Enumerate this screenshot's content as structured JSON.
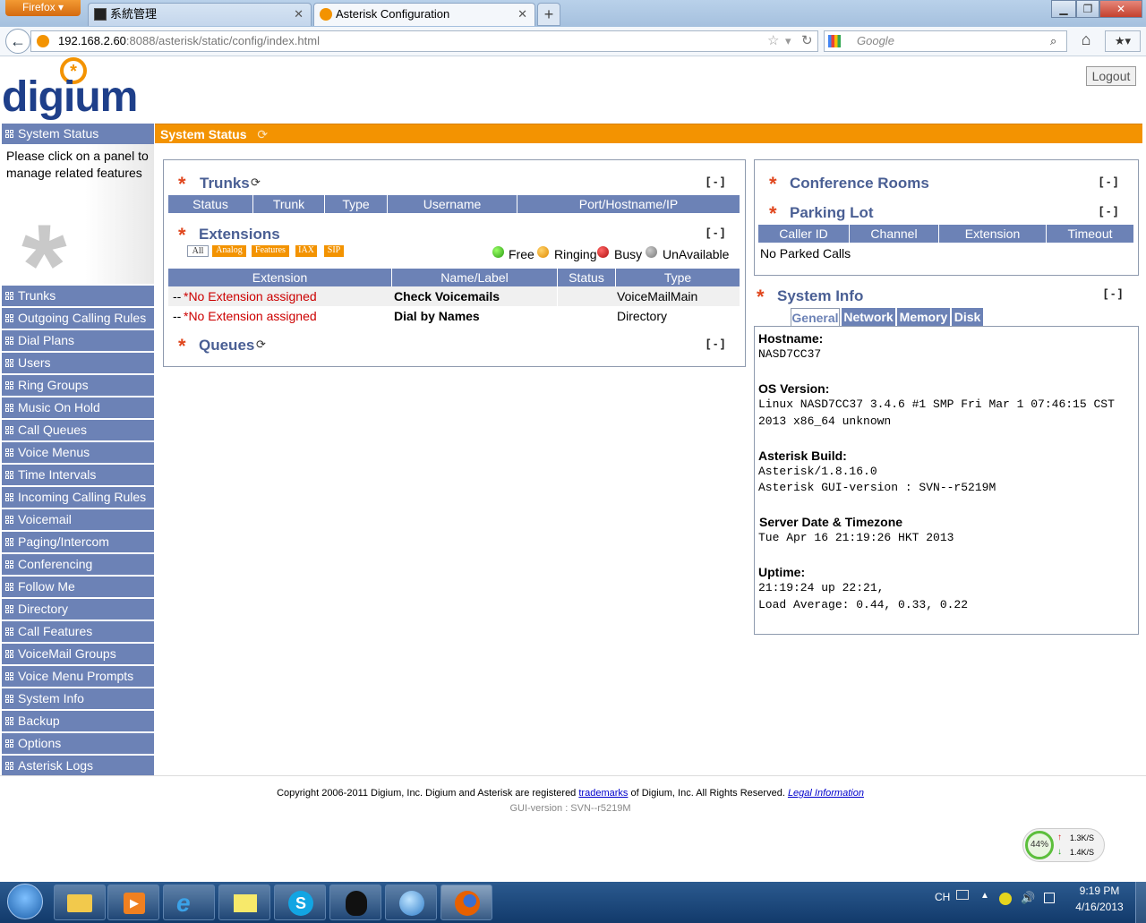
{
  "browser": {
    "menu_button": "Firefox",
    "tabs": [
      {
        "label": "系統管理"
      },
      {
        "label": "Asterisk Configuration"
      }
    ],
    "new_tab": "+",
    "url_host": "192.168.2.60",
    "url_path": ":8088/asterisk/static/config/index.html",
    "search_placeholder": "Google"
  },
  "header": {
    "logo_text": "digium",
    "logout_label": "Logout"
  },
  "sidebar": {
    "head_label": "System Status",
    "description": "Please click on a panel to manage related features",
    "items": [
      "Trunks",
      "Outgoing Calling Rules",
      "Dial Plans",
      "Users",
      "Ring Groups",
      "Music On Hold",
      "Call Queues",
      "Voice Menus",
      "Time Intervals",
      "Incoming Calling Rules",
      "Voicemail",
      "Paging/Intercom",
      "Conferencing",
      "Follow Me",
      "Directory",
      "Call Features",
      "VoiceMail Groups",
      "Voice Menu Prompts",
      "System Info",
      "Backup",
      "Options",
      "Asterisk Logs"
    ]
  },
  "status_bar": {
    "title": "System Status"
  },
  "trunks": {
    "title": "Trunks",
    "collapse": "[ - ]",
    "columns": [
      "Status",
      "Trunk",
      "Type",
      "Username",
      "Port/Hostname/IP"
    ]
  },
  "extensions": {
    "title": "Extensions",
    "collapse": "[ - ]",
    "filters": [
      "All",
      "Analog",
      "Features",
      "IAX",
      "SIP"
    ],
    "legend": [
      "Free",
      "Ringing",
      "Busy",
      "UnAvailable"
    ],
    "columns": [
      "Extension",
      "Name/Label",
      "Status",
      "Type"
    ],
    "rows": [
      {
        "prefix": "--",
        "extension": "*No Extension assigned",
        "name": "Check Voicemails",
        "status": "",
        "type": "VoiceMailMain"
      },
      {
        "prefix": "--",
        "extension": "*No Extension assigned",
        "name": "Dial by Names",
        "status": "",
        "type": "Directory"
      }
    ]
  },
  "queues": {
    "title": "Queues",
    "collapse": "[ - ]"
  },
  "conference": {
    "title": "Conference Rooms",
    "collapse": "[ - ]"
  },
  "parking": {
    "title": "Parking Lot",
    "collapse": "[ - ]",
    "columns": [
      "Caller ID",
      "Channel",
      "Extension",
      "Timeout"
    ],
    "empty_text": "No Parked Calls"
  },
  "system_info": {
    "title": "System Info",
    "collapse": "[ - ]",
    "tabs": [
      "General",
      "Network",
      "Memory",
      "Disk"
    ],
    "hostname_label": "Hostname:",
    "hostname": "NASD7CC37",
    "os_label": "OS Version:",
    "os_line1": "Linux NASD7CC37 3.4.6 #1 SMP Fri Mar 1 07:46:15 CST",
    "os_line2": "2013 x86_64 unknown",
    "build_label": "Asterisk Build:",
    "build_line1": "Asterisk/1.8.16.0",
    "build_line2": "Asterisk GUI-version : SVN--r5219M",
    "date_label": "Server Date & Timezone",
    "date": "Tue Apr 16 21:19:26 HKT 2013",
    "uptime_label": "Uptime:",
    "uptime_line1": "21:19:24 up 22:21,",
    "uptime_line2": "Load Average: 0.44, 0.33, 0.22"
  },
  "footer": {
    "copyright_pre": "Copyright 2006-2011 Digium, Inc. Digium and Asterisk are registered",
    "trademarks_link": "trademarks",
    "copyright_post": "of Digium, Inc. All Rights Reserved.",
    "legal_link": "Legal Information",
    "gui_version": "GUI-version : SVN--r5219M"
  },
  "net_widget": {
    "percent": "44%",
    "up": "1.3K/S",
    "down": "1.4K/S"
  },
  "taskbar": {
    "lang": "CH",
    "time": "9:19 PM",
    "date": "4/16/2013"
  },
  "colors": {
    "accent_orange": "#f39301",
    "nav_blue": "#6c82b6",
    "title_blue": "#4a5f94",
    "star_red": "#e0461d"
  }
}
